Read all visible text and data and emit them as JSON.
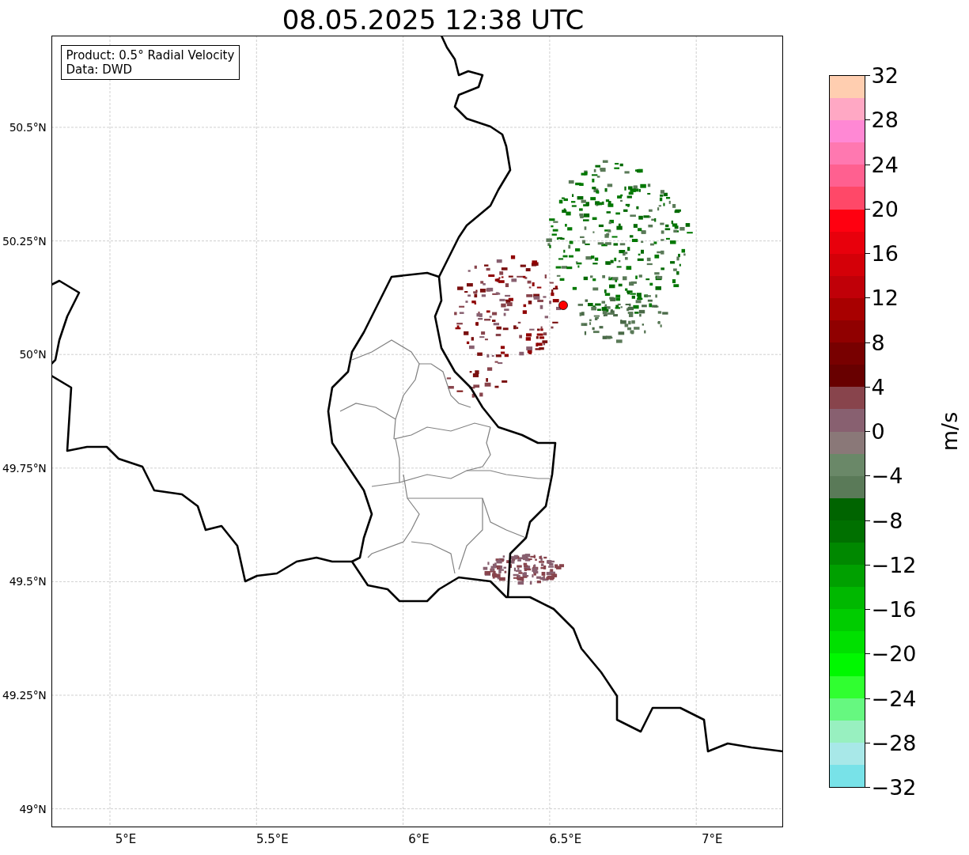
{
  "title": "08.05.2025 12:38 UTC",
  "info_box": {
    "lines": [
      "Product: 0.5° Radial Velocity",
      "Data: DWD"
    ]
  },
  "map": {
    "lat_ticks": [
      "50.5°N",
      "50.25°N",
      "50°N",
      "49.75°N",
      "49.5°N",
      "49.25°N",
      "49°N"
    ],
    "lon_ticks": [
      "5°E",
      "5.5°E",
      "6°E",
      "6.5°E",
      "7°E"
    ]
  },
  "colorbar": {
    "label": "m/s",
    "ticks": [
      "32",
      "28",
      "24",
      "20",
      "16",
      "12",
      "8",
      "4",
      "0",
      "−4",
      "−8",
      "−12",
      "−16",
      "−20",
      "−24",
      "−28",
      "−32"
    ]
  }
}
